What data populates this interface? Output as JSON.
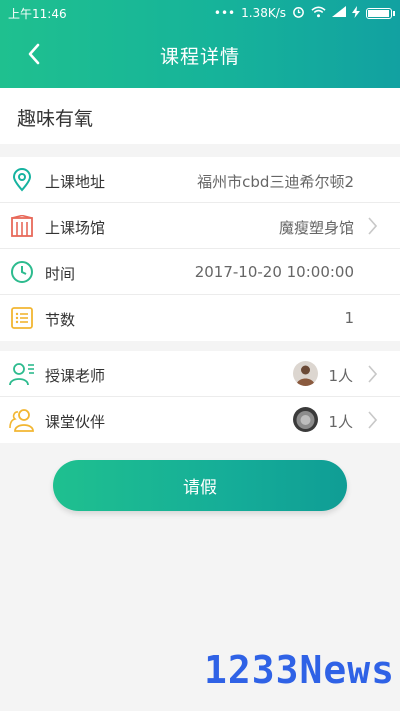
{
  "status_bar": {
    "time": "上午11:46",
    "net_speed": "1.38K/s",
    "battery_level": 0.88
  },
  "nav": {
    "title": "课程详情",
    "back_icon": "chevron-left-icon"
  },
  "course": {
    "name": "趣味有氧"
  },
  "details": [
    {
      "icon": "location-pin-icon",
      "label": "上课地址",
      "value": "福州市cbd三迪希尔顿2"
    },
    {
      "icon": "building-icon",
      "label": "上课场馆",
      "value": "魔瘦塑身馆"
    },
    {
      "icon": "clock-icon",
      "label": "时间",
      "value": "2017-10-20 10:00:00"
    },
    {
      "icon": "list-icon",
      "label": "节数",
      "value": "1"
    }
  ],
  "people": [
    {
      "icon": "teacher-icon",
      "label": "授课老师",
      "count": "1人"
    },
    {
      "icon": "partners-icon",
      "label": "课堂伙伴",
      "count": "1人"
    }
  ],
  "leave_button": {
    "label": "请假"
  },
  "watermark": "1233News",
  "colors": {
    "primary_start": "#1fc08f",
    "primary_end": "#12a1a1",
    "watermark": "#2f62e6"
  }
}
